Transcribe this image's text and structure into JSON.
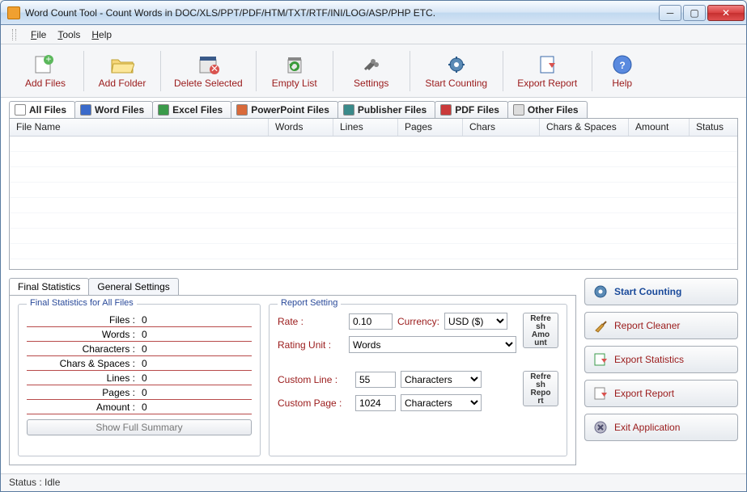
{
  "window": {
    "title": "Word Count Tool - Count Words in DOC/XLS/PPT/PDF/HTM/TXT/RTF/INI/LOG/ASP/PHP ETC."
  },
  "menu": {
    "file": "File",
    "tools": "Tools",
    "help": "Help"
  },
  "toolbar": {
    "add_files": "Add Files",
    "add_folder": "Add Folder",
    "delete_selected": "Delete Selected",
    "empty_list": "Empty List",
    "settings": "Settings",
    "start_counting": "Start Counting",
    "export_report": "Export Report",
    "help": "Help"
  },
  "file_tabs": {
    "all": "All Files",
    "word": "Word Files",
    "excel": "Excel Files",
    "ppt": "PowerPoint Files",
    "pub": "Publisher Files",
    "pdf": "PDF Files",
    "other": "Other Files"
  },
  "grid": {
    "file_name": "File Name",
    "words": "Words",
    "lines": "Lines",
    "pages": "Pages",
    "chars": "Chars",
    "chars_spaces": "Chars & Spaces",
    "amount": "Amount",
    "status": "Status"
  },
  "bottom_tabs": {
    "final": "Final Statistics",
    "general": "General Settings"
  },
  "stats": {
    "legend": "Final Statistics for All Files",
    "files_l": "Files :",
    "files_v": "0",
    "words_l": "Words :",
    "words_v": "0",
    "chars_l": "Characters :",
    "chars_v": "0",
    "cs_l": "Chars & Spaces :",
    "cs_v": "0",
    "lines_l": "Lines :",
    "lines_v": "0",
    "pages_l": "Pages :",
    "pages_v": "0",
    "amount_l": "Amount :",
    "amount_v": "0",
    "summary_btn": "Show Full Summary"
  },
  "report": {
    "legend": "Report Setting",
    "rate_l": "Rate :",
    "rate_v": "0.10",
    "currency_l": "Currency:",
    "currency_v": "USD ($)",
    "unit_l": "Rating Unit :",
    "unit_v": "Words",
    "cline_l": "Custom Line :",
    "cline_v": "55",
    "cline_unit": "Characters",
    "cpage_l": "Custom Page :",
    "cpage_v": "1024",
    "cpage_unit": "Characters",
    "refresh_amount": "Refresh Amount",
    "refresh_report": "Refresh Report"
  },
  "actions": {
    "start": "Start Counting",
    "cleaner": "Report Cleaner",
    "export_stats": "Export Statistics",
    "export_report": "Export Report",
    "exit": "Exit Application"
  },
  "status": {
    "text": "Status :  Idle"
  }
}
